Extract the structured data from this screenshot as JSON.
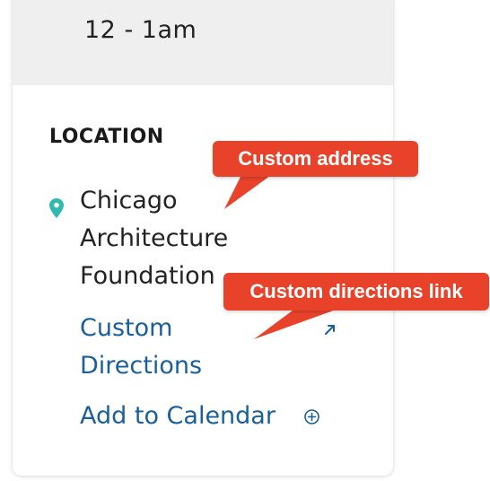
{
  "event": {
    "time": "12 - 1am"
  },
  "location": {
    "heading": "LOCATION",
    "icon": "map-pin-icon",
    "address_lines": [
      "Chicago",
      "Architecture",
      "Foundation"
    ],
    "directions_lines": [
      "Custom",
      "Directions"
    ],
    "directions_icon": "external-link-icon",
    "calendar_label": "Add to Calendar",
    "calendar_icon": "circle-plus-icon"
  },
  "annotations": {
    "address": "Custom address",
    "directions": "Custom directions link"
  },
  "colors": {
    "accent_link": "#1a5e9a",
    "pin": "#2fb9b0",
    "callout": "#e8432a",
    "time_band": "#efefef"
  }
}
